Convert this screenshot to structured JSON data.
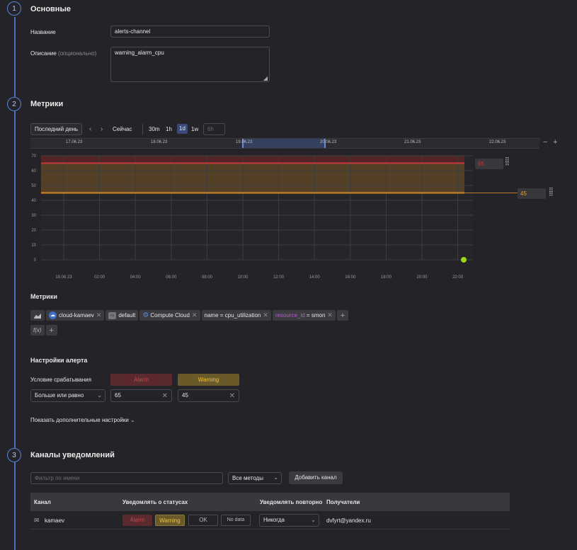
{
  "steps": [
    {
      "num": "1",
      "title": "Основные"
    },
    {
      "num": "2",
      "title": "Метрики"
    },
    {
      "num": "3",
      "title": "Каналы уведомлений"
    }
  ],
  "general": {
    "name_label": "Название",
    "name_value": "alerts-channel",
    "desc_label": "Описание",
    "desc_hint": "(опционально)",
    "desc_value": "warning_alarm_cpu"
  },
  "time_toolbar": {
    "range_button": "Последний день",
    "prev": "‹",
    "next": "›",
    "now": "Сейчас",
    "presets": [
      "30m",
      "1h",
      "1d",
      "1w"
    ],
    "active_preset": "1d",
    "custom_placeholder": "6h",
    "minus": "−",
    "plus": "+"
  },
  "timeline": {
    "dates": [
      "17.06.23",
      "18.06.23",
      "19.06.23",
      "20.06.23",
      "21.06.23",
      "22.06.23"
    ]
  },
  "chart_data": {
    "type": "line",
    "y_ticks": [
      "0",
      "10",
      "20",
      "30",
      "40",
      "50",
      "60",
      "70"
    ],
    "ylim": [
      0,
      70
    ],
    "x_ticks": [
      "19.06.23",
      "02:00",
      "04:00",
      "06:00",
      "08:00",
      "10:00",
      "12:00",
      "14:00",
      "16:00",
      "18:00",
      "20:00",
      "22:00"
    ],
    "thresholds": [
      {
        "name": "Alarm",
        "value": 65,
        "color": "#c23a3a"
      },
      {
        "name": "Warning",
        "value": 45,
        "color": "#d8862a"
      }
    ],
    "threshold_labels": [
      "65",
      "45"
    ],
    "series": [
      {
        "points": [
          {
            "x": "22:20",
            "y": 0
          }
        ],
        "color": "#9fd61c"
      }
    ],
    "grid": true
  },
  "metrics": {
    "title": "Метрики",
    "chips": [
      {
        "icon": "cloud-icon",
        "text": "cloud-kamaev"
      },
      {
        "icon": "folder-icon",
        "text": "default"
      },
      {
        "icon": "gear-icon",
        "text": "Compute Cloud"
      },
      {
        "key": "name",
        "op": " = ",
        "value": "cpu_utilization"
      },
      {
        "key": "resource_id",
        "op": " = ",
        "value": "smon"
      }
    ],
    "add": "+",
    "func": "f(x)"
  },
  "alert_settings": {
    "title": "Настройки алерта",
    "condition_label": "Условие срабатывания",
    "alarm_label": "Alarm",
    "warning_label": "Warning",
    "condition_value": "Больше или равно",
    "alarm_value": "65",
    "warning_value": "45",
    "more_settings": "Показать дополнительные настройки"
  },
  "channels": {
    "filter_placeholder": "Фильтр по имени",
    "methods_select": "Все методы",
    "add_button": "Добавить канал",
    "headers": [
      "Канал",
      "Уведомлять о статусах",
      "Уведомлять повторно",
      "Получатели"
    ],
    "rows": [
      {
        "name": "kamaev",
        "statuses": [
          "Alarm",
          "Warning",
          "OK",
          "No data"
        ],
        "repeat": "Никогда",
        "recipients": "dvfyrt@yandex.ru"
      }
    ]
  },
  "colors": {
    "alarm": "#c23a3a",
    "warning": "#d8862a",
    "accent": "#5a80d8"
  }
}
